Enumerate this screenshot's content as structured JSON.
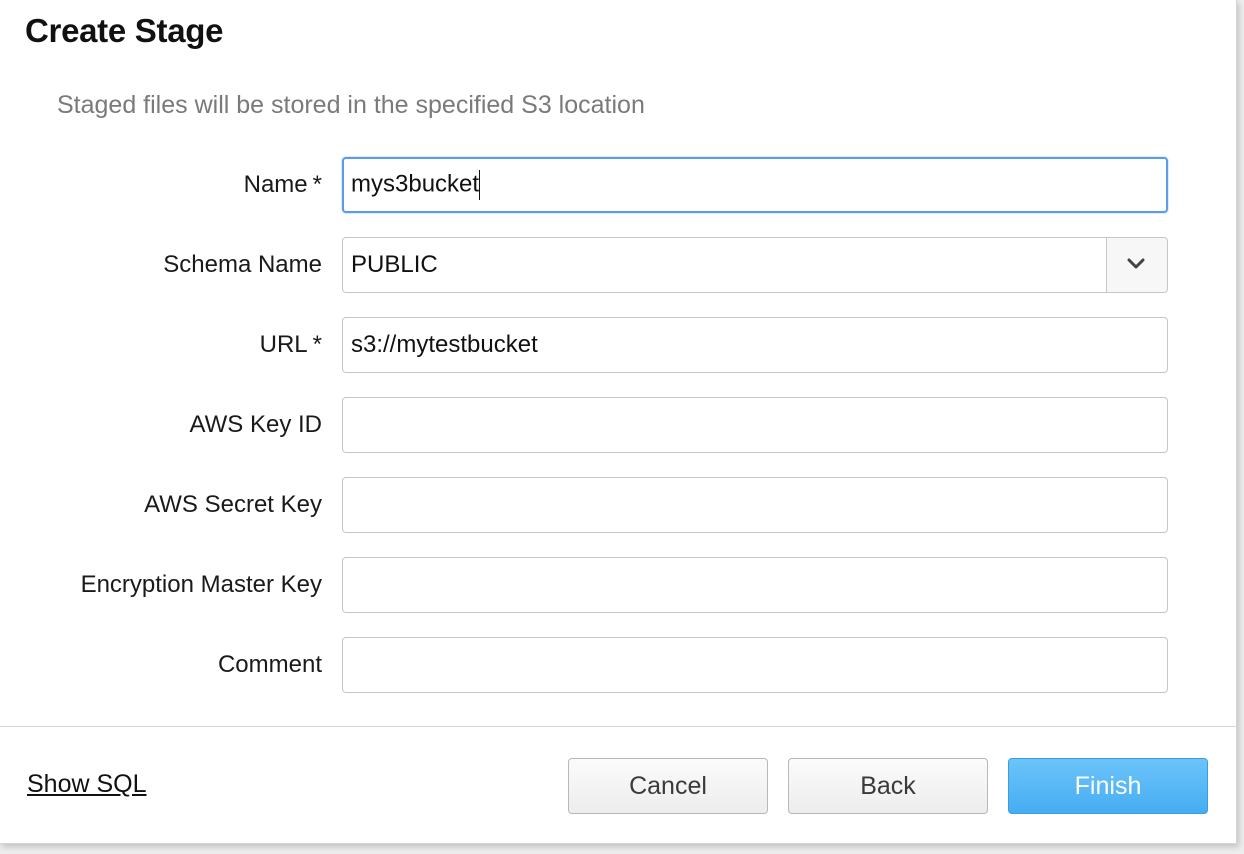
{
  "dialog": {
    "title": "Create Stage",
    "subtitle": "Staged files will be stored in the specified S3 location"
  },
  "form": {
    "required_marker": "*",
    "name": {
      "label": "Name",
      "value": "mys3bucket"
    },
    "schema": {
      "label": "Schema Name",
      "value": "PUBLIC"
    },
    "url": {
      "label": "URL",
      "value": "s3://mytestbucket"
    },
    "aws_key_id": {
      "label": "AWS Key ID",
      "value": ""
    },
    "aws_secret_key": {
      "label": "AWS Secret Key",
      "value": ""
    },
    "encryption_master_key": {
      "label": "Encryption Master Key",
      "value": ""
    },
    "comment": {
      "label": "Comment",
      "value": ""
    }
  },
  "footer": {
    "show_sql": "Show SQL",
    "cancel": "Cancel",
    "back": "Back",
    "finish": "Finish"
  },
  "colors": {
    "primary_button": "#46adf2",
    "focus_border": "#5b9be8",
    "subtitle": "#7a7a7a"
  },
  "icons": {
    "select_arrow": "chevron-down-icon"
  }
}
